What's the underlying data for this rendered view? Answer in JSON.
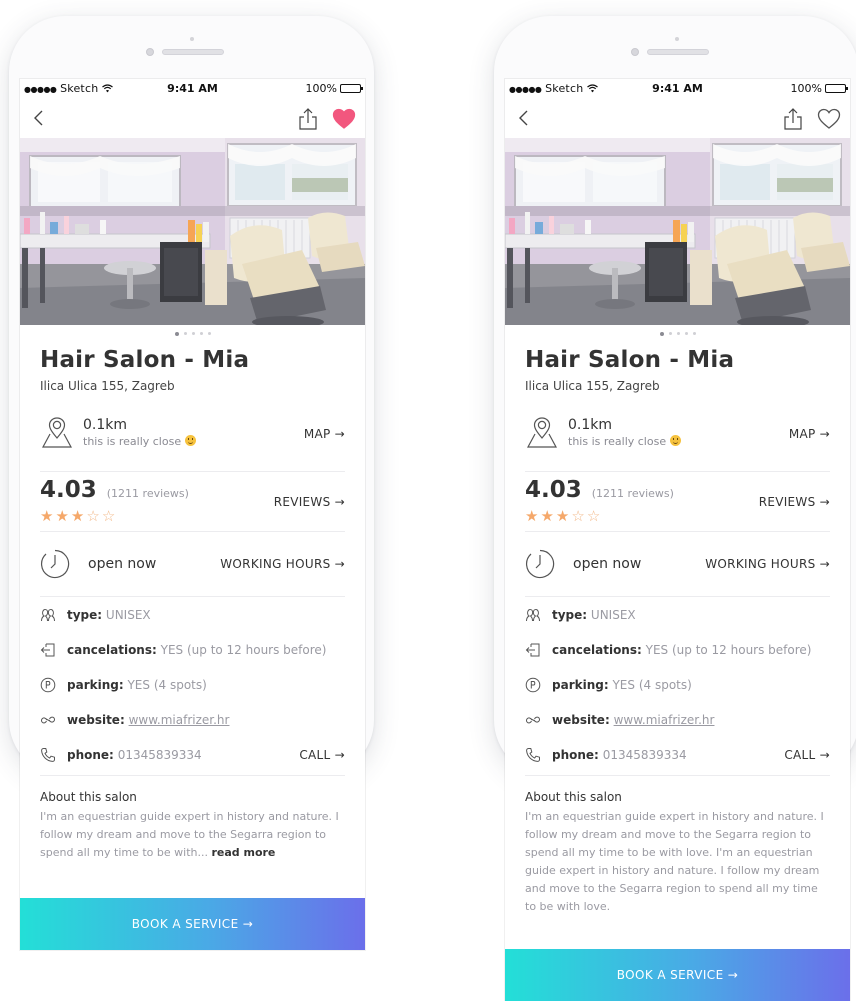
{
  "status_bar": {
    "dots": "●●●●●",
    "carrier": "Sketch",
    "time": "9:41 AM",
    "battery": "100%",
    "battery_level": 1.0
  },
  "salon": {
    "name": "Hair Salon - Mia",
    "address": "Ilica Ulica 155, Zagreb",
    "distance": "0.1km",
    "distance_note": "this is really close",
    "map_label": "MAP →",
    "rating": "4.03",
    "reviews": "(1211 reviews)",
    "reviews_label": "REVIEWS →",
    "stars_filled": 3,
    "stars_total": 5,
    "open_status": "open now",
    "hours_label": "WORKING HOURS →",
    "type_label": "type:",
    "type_value": "UNISEX",
    "cancel_label": "cancelations:",
    "cancel_value": "YES (up to 12 hours before)",
    "parking_label": "parking:",
    "parking_value": "YES (4 spots)",
    "website_label": "website:",
    "website_value": "www.miafrizer.hr",
    "phone_label": "phone:",
    "phone_value": "01345839334",
    "call_label": "CALL →",
    "about_title": "About this salon",
    "book_label": "BOOK A SERVICE →"
  },
  "left": {
    "favorited": true,
    "about_text": "I'm an equestrian guide expert in history and nature. I follow my dream and move to the Segarra region to spend all my time to be with...",
    "read_more": "read more"
  },
  "right": {
    "favorited": false,
    "about_text": "I'm an equestrian guide expert in history and nature. I follow my dream and move to the Segarra region to spend all my time to be with love. I'm an equestrian guide expert in history and nature. I follow my dream and move to the Segarra region to spend all my time to be with love."
  },
  "carousel": {
    "pages": 5,
    "active_index": 0
  },
  "colors": {
    "heart_active": "#f2577e",
    "star": "#f5a86a",
    "gradient_start": "#23dfd7",
    "gradient_end": "#6b6fea"
  },
  "icons": {
    "back": "chevron-left-icon",
    "share": "share-icon",
    "heart": "heart-icon",
    "pin": "map-pin-icon",
    "clock": "clock-icon",
    "type": "people-icon",
    "cancel": "exit-icon",
    "parking": "parking-icon",
    "website": "link-icon",
    "phone": "phone-icon"
  }
}
